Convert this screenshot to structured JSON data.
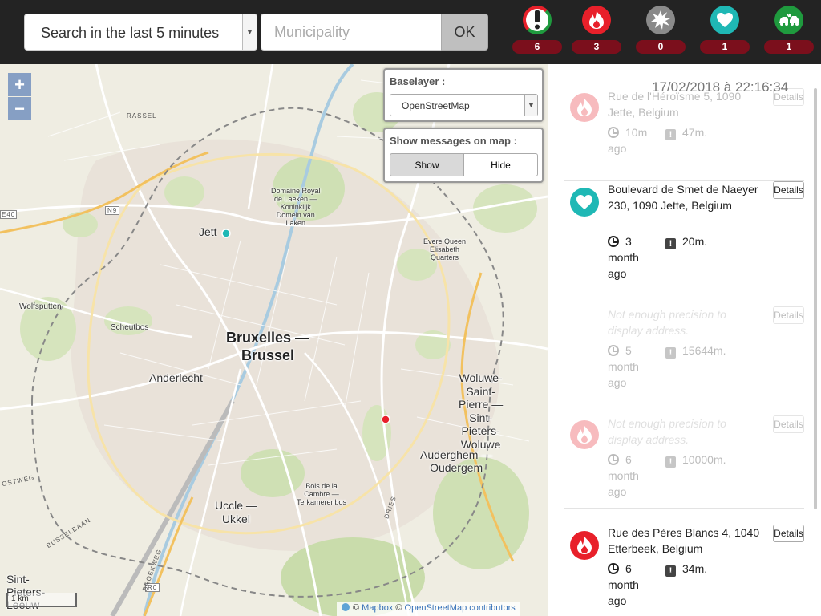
{
  "toolbar": {
    "time_filter": "Search in the last 5 minutes",
    "municipality_placeholder": "Municipality",
    "ok_label": "OK"
  },
  "categories": [
    {
      "icon": "exclamation-icon",
      "color": "#1f9a3e",
      "count": "6"
    },
    {
      "icon": "fire-icon",
      "color": "#e8202a",
      "count": "3"
    },
    {
      "icon": "explosion-icon",
      "color": "#8a8a8a",
      "count": "0"
    },
    {
      "icon": "heart-icon",
      "color": "#1fb8b5",
      "count": "1"
    },
    {
      "icon": "car-crash-icon",
      "color": "#1f9a3e",
      "count": "1"
    }
  ],
  "map": {
    "baselayer_title": "Baselayer :",
    "baselayer_value": "OpenStreetMap",
    "show_messages_title": "Show messages on map :",
    "show_label": "Show",
    "hide_label": "Hide",
    "zoom_in": "+",
    "zoom_out": "−",
    "scale": "1 km",
    "attribution_prefix": "©",
    "attribution_mapbox": "Mapbox",
    "attribution_osm": "OpenStreetMap contributors",
    "labels": {
      "rassel": "RASSEL",
      "domaine": "Domaine Royal\nde Laeken —\nKoninklijk\nDomein van\nLaken",
      "jett": "Jett",
      "evere": "Evere Queen\nElisabeth\nQuarters",
      "wolfsputten": "Wolfsputten",
      "scheutbos": "Scheutbos",
      "bruxelles": "Bruxelles —\nBrussel",
      "anderlecht": "Anderlecht",
      "woluwe": "Woluwe-\nSaint-\nPierre —\nSint-\nPieters-\nWoluwe",
      "auderghem": "Auderghem —\nOudergem",
      "bois": "Bois de la\nCambre —\nTerkamerenbos",
      "uccle": "Uccle —\nUkkel",
      "sint": "Sint-\nPieters-\nLeeuw",
      "e40": "E40",
      "n9": "N9",
      "r0": "R0",
      "ostweg": "OSTWEG",
      "busselbaan": "BUSSELBAAN",
      "broekweg": "BROEKWEG",
      "dries": "DRIES"
    }
  },
  "panel": {
    "datetime": "17/02/2018 à 22:16:34",
    "details_label": "Details",
    "messages": [
      {
        "icon": "fire-icon",
        "color": "#e8202a",
        "address": "Rue de l'Héroïsme 5, 1090 Jette, Belgium",
        "time": "10m ago",
        "precision": "47m.",
        "faded": true
      },
      {
        "icon": "heart-icon",
        "color": "#1fb8b5",
        "address": "Boulevard de Smet de Naeyer 230, 1090 Jette, Belgium",
        "time": "3 month ago",
        "precision": "20m.",
        "faded": false
      },
      {
        "icon": "",
        "color": "",
        "address": "Not enough precision to display address.",
        "time": "5 month ago",
        "precision": "15644m.",
        "faded": true
      },
      {
        "icon": "fire-icon",
        "color": "#e8202a",
        "address": "Not enough precision to display address.",
        "time": "6 month ago",
        "precision": "10000m.",
        "faded": true
      },
      {
        "icon": "fire-icon",
        "color": "#e8202a",
        "address": "Rue des Pères Blancs 4, 1040 Etterbeek, Belgium",
        "time": "6 month ago",
        "precision": "34m.",
        "faded": false
      }
    ]
  }
}
